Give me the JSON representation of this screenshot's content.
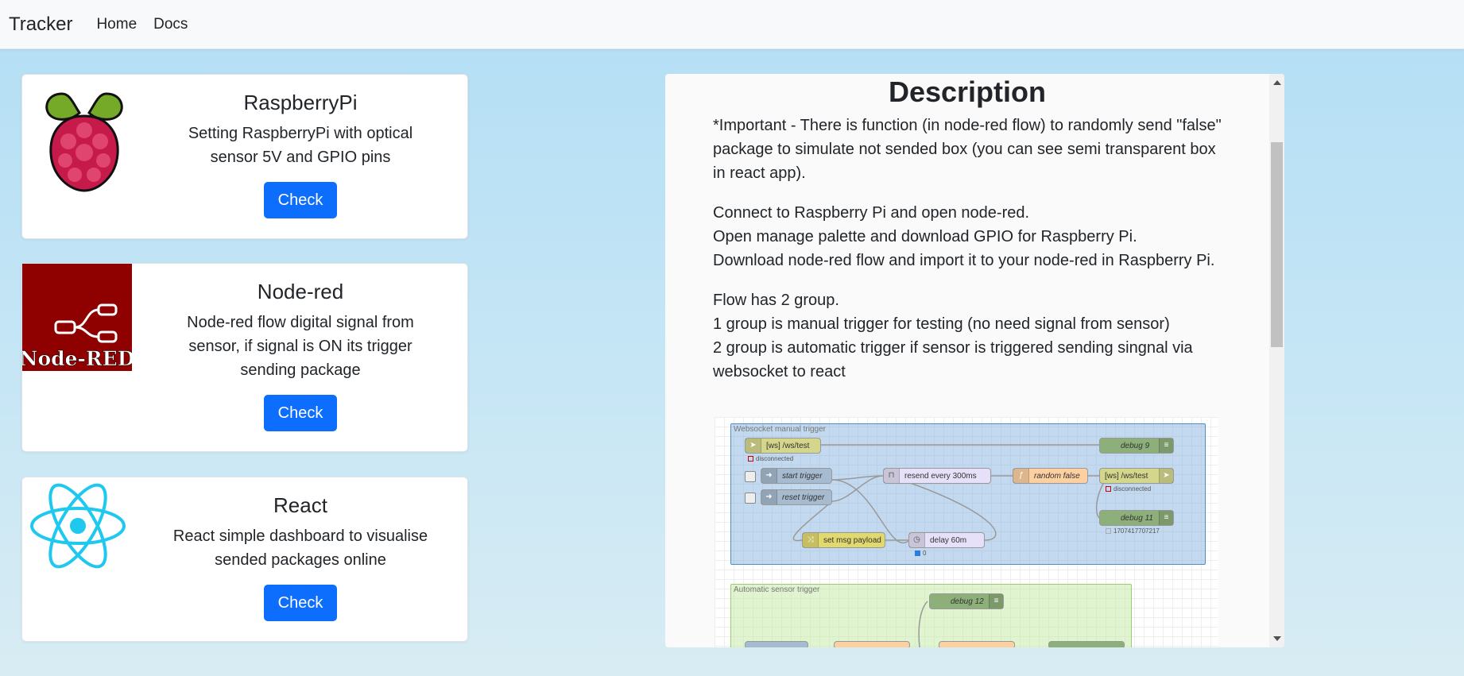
{
  "navbar": {
    "brand": "Tracker",
    "links": [
      "Home",
      "Docs"
    ]
  },
  "cards": [
    {
      "title": "RaspberryPi",
      "text": "Setting RaspberryPi with optical sensor 5V and GPIO pins",
      "button": "Check",
      "icon": "raspberry-pi-logo"
    },
    {
      "title": "Node-red",
      "text": "Node-red flow digital signal from sensor, if signal is ON its trigger sending package",
      "button": "Check",
      "icon": "node-red-logo",
      "logo_text": "Node-RED"
    },
    {
      "title": "React",
      "text": "React simple dashboard to visualise sended packages online",
      "button": "Check",
      "icon": "react-logo"
    }
  ],
  "description": {
    "title": "Description",
    "paragraphs": [
      "*Important - There is function (in node-red flow) to randomly send \"false\" package to simulate not sended box (you can see semi transparent box in react app).",
      "Connect to Raspberry Pi and open node-red.\nOpen manage palette and download GPIO for Raspberry Pi.\nDownload node-red flow and import it to your node-red in Raspberry Pi.",
      "Flow has 2 group.\n1 group is manual trigger for testing (no need signal from sensor)\n2 group is automatic trigger if sensor is triggered sending singnal via websocket to react"
    ]
  },
  "flow": {
    "group1_label": "Websocket manual trigger",
    "group2_label": "Automatic sensor trigger",
    "nodes": {
      "ws_in": "[ws] /ws/test",
      "debug9": "debug 9",
      "start": "start trigger",
      "reset": "reset trigger",
      "resend": "resend every 300ms",
      "random": "random false",
      "ws_out": "[ws] /ws/test",
      "debug11": "debug 11",
      "setmsg": "set msg payload",
      "delay": "delay 60m",
      "debug12": "debug 12"
    },
    "status": {
      "disconnected1": "disconnected",
      "disconnected2": "disconnected",
      "timestamp": "1707417707217",
      "delay_count": "0"
    }
  },
  "colors": {
    "primary": "#0d6efd",
    "node_red": "#8f0000",
    "react": "#1ec8ee"
  }
}
